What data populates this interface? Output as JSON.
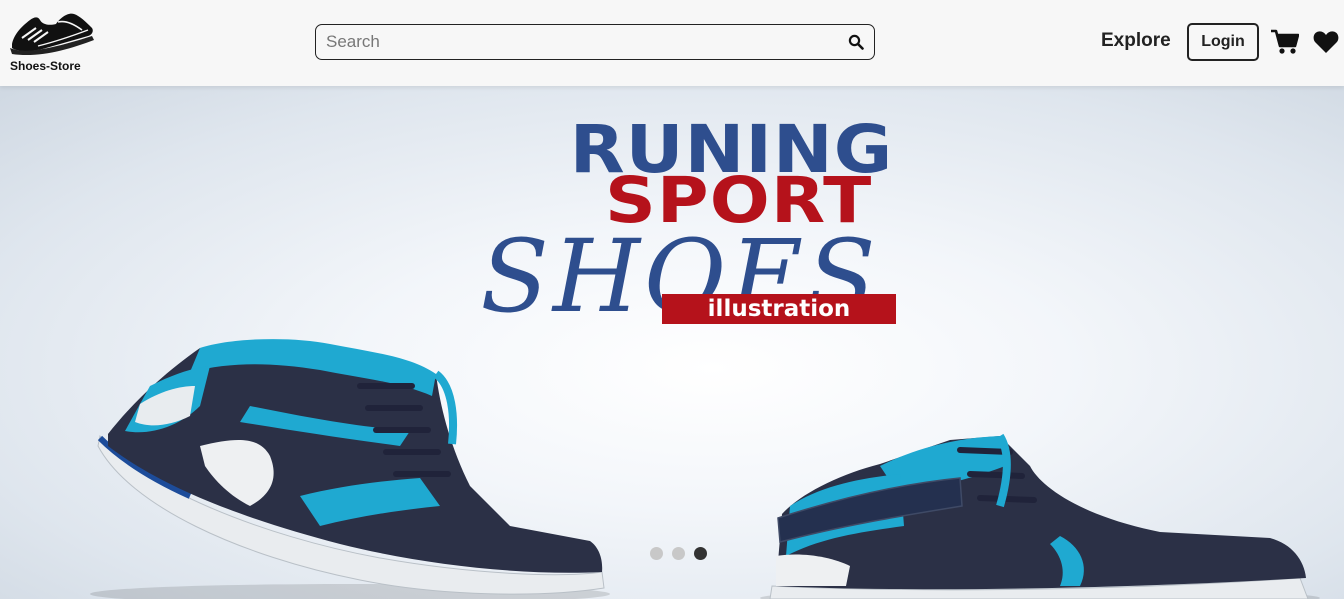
{
  "navbar": {
    "brand_name": "Shoes-Store",
    "brand_icon": "sneaker-logo-icon",
    "search": {
      "placeholder": "Search",
      "value": "",
      "icon": "search-icon"
    },
    "explore_label": "Explore",
    "login_label": "Login",
    "cart_icon": "cart-icon",
    "wishlist_icon": "heart-icon"
  },
  "hero": {
    "slide_title_1": "RUNING",
    "slide_title_2": "SPORT",
    "slide_title_3": "SHOES",
    "slide_tag": "illustration",
    "slides_count": 3,
    "active_slide_index": 3
  },
  "colors": {
    "navbar_bg": "#f7f7f7",
    "title_blue": "#2e4e8e",
    "title_red": "#b5121b",
    "shoe_teal": "#1fa9d1",
    "shoe_navy": "#2b3046"
  }
}
